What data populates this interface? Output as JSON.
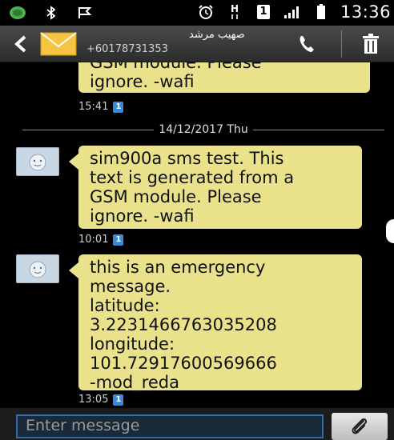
{
  "status_bar": {
    "time": "13:36",
    "sim_badge": "1",
    "data_indicator": "H",
    "icons": [
      "whatsapp-icon",
      "bluetooth-icon",
      "flag-icon",
      "alarm-icon",
      "data-h-icon",
      "sim1-icon",
      "signal-icon",
      "battery-icon"
    ]
  },
  "header": {
    "contact_name": "صهيب مرشد",
    "contact_number": "+60178731353",
    "icons": [
      "back-icon",
      "envelope-icon",
      "phone-icon",
      "trash-icon"
    ]
  },
  "messages": [
    {
      "lines": [
        "GSM module. Please",
        "ignore. -wafi"
      ],
      "time": "15:41",
      "sim": "1"
    },
    {
      "lines": [
        "sim900a sms test. This",
        "text is generated from a",
        "GSM module. Please",
        "ignore. -wafi"
      ],
      "time": "10:01",
      "sim": "1"
    },
    {
      "lines": [
        "this is an emergency",
        "message.",
        "latitude:",
        "3.2231466763035208",
        "longitude:",
        "101.72917600569666",
        "-mod_reda"
      ],
      "time": "13:05",
      "sim": "1"
    }
  ],
  "date_separator": "14/12/2017 Thu",
  "composer": {
    "placeholder": "Enter message"
  },
  "colors": {
    "bubble": "#e9e28a",
    "background": "#000000",
    "input_border": "#2f6ea8",
    "sim_badge": "#3a8ad8"
  }
}
